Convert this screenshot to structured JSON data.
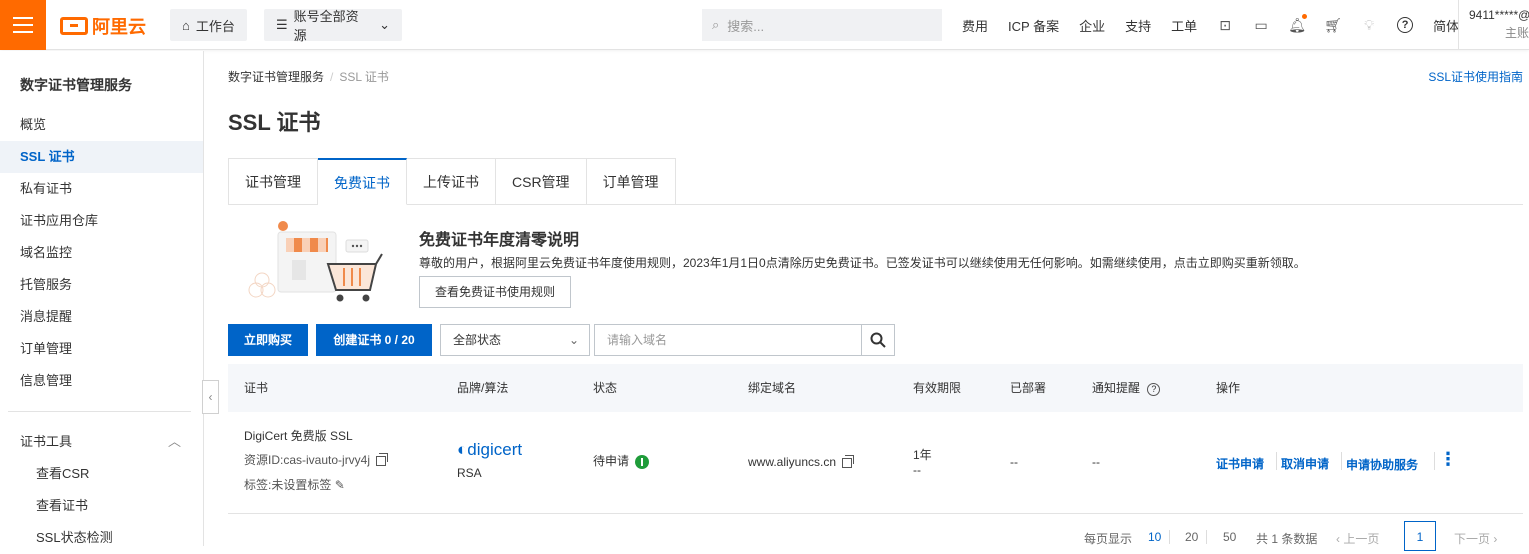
{
  "brand": {
    "logo_text": "阿里云",
    "accent": "#ff6a00",
    "primary": "#0064c8"
  },
  "topbar": {
    "workbench": "工作台",
    "resources": "账号全部资源",
    "search_placeholder": "搜索...",
    "links": [
      "费用",
      "ICP 备案",
      "企业",
      "支持",
      "工单"
    ],
    "lang": "简体",
    "user": "9411*****@",
    "user_role": "主账"
  },
  "sidebar": {
    "title": "数字证书管理服务",
    "items": [
      "概览",
      "SSL 证书",
      "私有证书",
      "证书应用仓库",
      "域名监控",
      "托管服务",
      "消息提醒",
      "订单管理",
      "信息管理"
    ],
    "active_index": 1,
    "group": "证书工具",
    "sub_items": [
      "查看CSR",
      "查看证书",
      "SSL状态检测"
    ]
  },
  "main": {
    "breadcrumb": [
      "数字证书管理服务",
      "SSL 证书"
    ],
    "guide_link": "SSL证书使用指南",
    "title": "SSL 证书",
    "tabs": [
      "证书管理",
      "免费证书",
      "上传证书",
      "CSR管理",
      "订单管理"
    ],
    "active_tab": 1,
    "notice": {
      "title": "免费证书年度清零说明",
      "text": "尊敬的用户，根据阿里云免费证书年度使用规则，2023年1月1日0点清除历史免费证书。已签发证书可以继续使用无任何影响。如需继续使用，点击立即购买重新领取。",
      "button": "查看免费证书使用规则"
    },
    "toolbar": {
      "buy": "立即购买",
      "create": "创建证书 0 / 20",
      "status_select": "全部状态",
      "domain_placeholder": "请输入域名"
    },
    "table": {
      "headers": [
        "证书",
        "品牌/算法",
        "状态",
        "绑定域名",
        "有效期限",
        "已部署",
        "通知提醒",
        "操作"
      ],
      "rows": [
        {
          "cert_name": "DigiCert 免费版 SSL",
          "resource_id": "资源ID:cas-ivauto-jrvy4j",
          "tags": "标签:未设置标签",
          "brand": "digicert",
          "algo": "RSA",
          "status": "待申请",
          "domain": "www.aliyuncs.cn",
          "validity": "1年",
          "validity_sub": "--",
          "deployed": "--",
          "notify": "--",
          "actions": [
            "证书申请",
            "取消申请",
            "申请协助服务"
          ]
        }
      ]
    },
    "pager": {
      "per_page_label": "每页显示",
      "sizes": [
        "10",
        "20",
        "50"
      ],
      "total": "共 1 条数据",
      "prev": "上一页",
      "current": "1",
      "next": "下一页"
    }
  }
}
